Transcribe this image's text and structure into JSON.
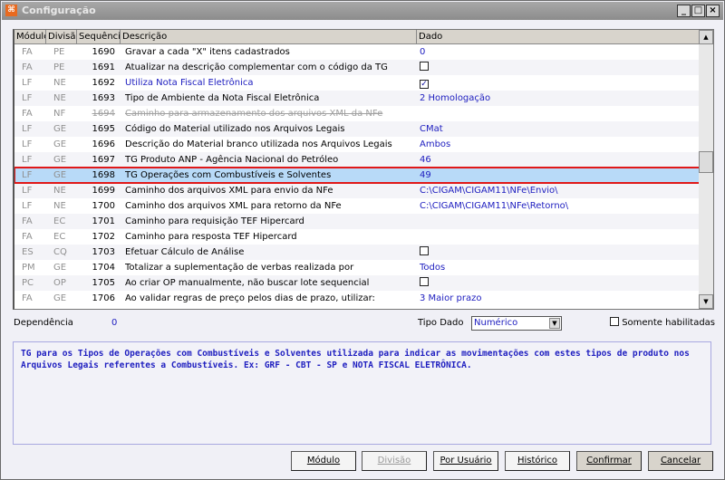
{
  "window": {
    "title": "Configuração",
    "icon": "app-icon",
    "controls": [
      "_",
      "□",
      "×"
    ]
  },
  "grid": {
    "columns": [
      "Módulo",
      "Divisão",
      "Sequência",
      "Descrição",
      "Dado"
    ],
    "rows": [
      {
        "modulo": "FA",
        "divisao": "PE",
        "seq": "1690",
        "desc": "Gravar a cada \"X\" itens cadastrados",
        "dado": "0",
        "type": "text"
      },
      {
        "modulo": "FA",
        "divisao": "PE",
        "seq": "1691",
        "desc": "Atualizar na descrição complementar com o código da TG",
        "dado": "",
        "type": "checkbox",
        "checked": false
      },
      {
        "modulo": "LF",
        "divisao": "NE",
        "seq": "1692",
        "desc": "Utiliza Nota Fiscal Eletrônica",
        "dado": "",
        "type": "checkbox",
        "checked": true,
        "style": "blue"
      },
      {
        "modulo": "LF",
        "divisao": "NE",
        "seq": "1693",
        "desc": "Tipo de Ambiente da Nota Fiscal Eletrônica",
        "dado": "2 Homologação",
        "type": "text"
      },
      {
        "modulo": "FA",
        "divisao": "NF",
        "seq": "1694",
        "desc": "Caminho para armazenamento dos arquivos XML da NFe",
        "dado": "",
        "type": "text",
        "style": "strike"
      },
      {
        "modulo": "LF",
        "divisao": "GE",
        "seq": "1695",
        "desc": "Código do Material utilizado nos Arquivos Legais",
        "dado": "CMat",
        "type": "text"
      },
      {
        "modulo": "LF",
        "divisao": "GE",
        "seq": "1696",
        "desc": "Descrição do Material branco utilizada nos Arquivos Legais",
        "dado": "Ambos",
        "type": "text"
      },
      {
        "modulo": "LF",
        "divisao": "GE",
        "seq": "1697",
        "desc": "TG Produto ANP - Agência Nacional do Petróleo",
        "dado": "46",
        "type": "text"
      },
      {
        "modulo": "LF",
        "divisao": "GE",
        "seq": "1698",
        "desc": "TG Operações com Combustíveis e Solventes",
        "dado": "49",
        "type": "text",
        "selected": true
      },
      {
        "modulo": "LF",
        "divisao": "NE",
        "seq": "1699",
        "desc": "Caminho dos arquivos XML para envio da NFe",
        "dado": "C:\\CIGAM\\CIGAM11\\NFe\\Envio\\",
        "type": "text"
      },
      {
        "modulo": "LF",
        "divisao": "NE",
        "seq": "1700",
        "desc": "Caminho dos arquivos XML para retorno da NFe",
        "dado": "C:\\CIGAM\\CIGAM11\\NFe\\Retorno\\",
        "type": "text"
      },
      {
        "modulo": "FA",
        "divisao": "EC",
        "seq": "1701",
        "desc": "Caminho para requisição TEF Hipercard",
        "dado": "",
        "type": "text"
      },
      {
        "modulo": "FA",
        "divisao": "EC",
        "seq": "1702",
        "desc": "Caminho para resposta TEF Hipercard",
        "dado": "",
        "type": "text"
      },
      {
        "modulo": "ES",
        "divisao": "CQ",
        "seq": "1703",
        "desc": "Efetuar Cálculo de Análise",
        "dado": "",
        "type": "checkbox",
        "checked": false
      },
      {
        "modulo": "PM",
        "divisao": "GE",
        "seq": "1704",
        "desc": "Totalizar a suplementação de verbas realizada por",
        "dado": "Todos",
        "type": "text"
      },
      {
        "modulo": "PC",
        "divisao": "OP",
        "seq": "1705",
        "desc": "Ao criar OP manualmente, não buscar lote sequencial",
        "dado": "",
        "type": "checkbox",
        "checked": false
      },
      {
        "modulo": "FA",
        "divisao": "GE",
        "seq": "1706",
        "desc": "Ao validar regras de preço pelos dias de prazo, utilizar:",
        "dado": "3 Maior prazo",
        "type": "text"
      }
    ],
    "scroll_position": 0.47
  },
  "footer": {
    "dependencia_label": "Dependência",
    "dependencia_value": "0",
    "tipo_dado_label": "Tipo Dado",
    "tipo_dado_value": "Numérico",
    "somente_habilitadas_label": "Somente habilitadas",
    "somente_habilitadas_checked": false
  },
  "memo": "TG para os Tipos de Operações com Combustíveis e Solventes utilizada para indicar as movimentações  com estes tipos de produto nos Arquivos Legais referentes a Combustíveis. Ex: GRF - CBT - SP e NOTA FISCAL ELETRÔNICA.",
  "buttons": {
    "modulo": "Módulo",
    "divisao": "Divisão",
    "por_usuario": "Por Usuário",
    "historico": "Histórico",
    "confirmar": "Confirmar",
    "cancelar": "Cancelar"
  },
  "colors": {
    "accent": "#2020c0",
    "selection": "#b8daf8",
    "highlight_border": "#e01818"
  }
}
